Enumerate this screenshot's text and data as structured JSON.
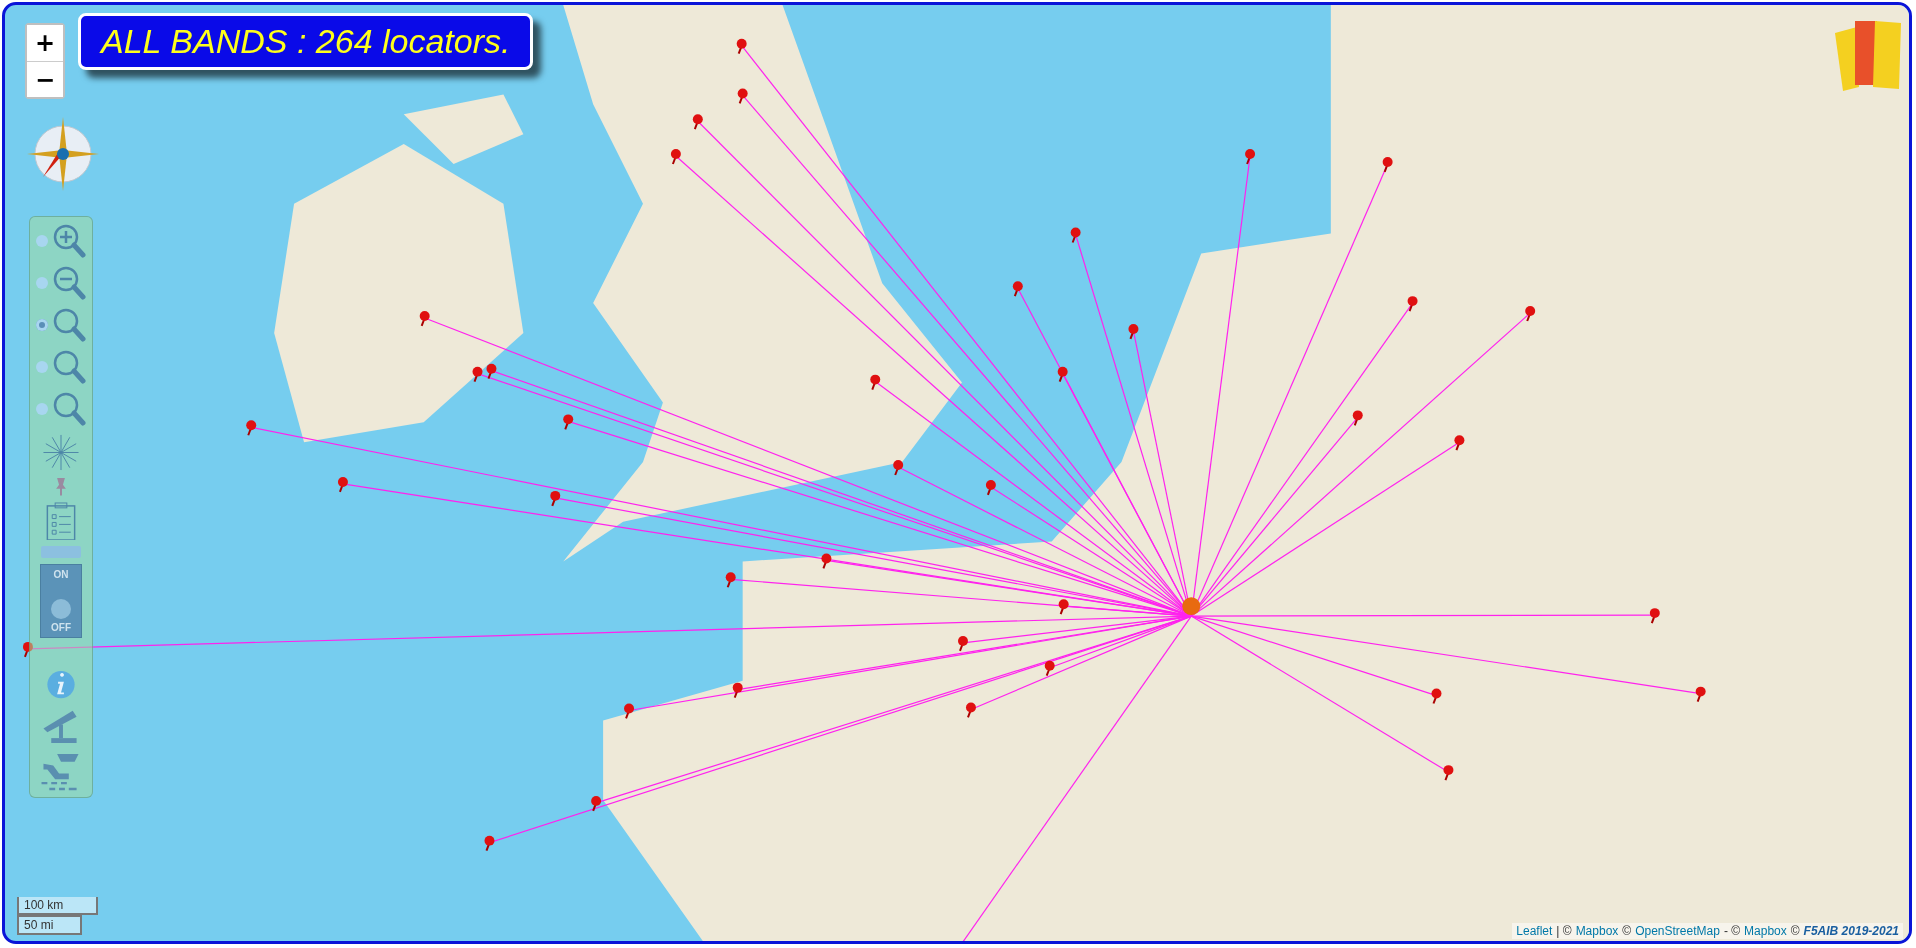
{
  "title": "ALL BANDS : 264 locators.",
  "zoom_controls": [
    "+",
    "−"
  ],
  "zoom_levels": [
    {
      "kind": "zoom-in",
      "selected": false
    },
    {
      "kind": "zoom-out",
      "selected": false
    },
    {
      "kind": "zoom",
      "selected": true
    },
    {
      "kind": "zoom",
      "selected": false
    },
    {
      "kind": "zoom",
      "selected": false
    }
  ],
  "toggle": {
    "on_label": "ON",
    "off_label": "OFF",
    "on": false
  },
  "scale": [
    "100 km",
    "50 mi"
  ],
  "attribution": [
    {
      "kind": "link",
      "text": "Leaflet"
    },
    {
      "kind": "text",
      "text": "| ©"
    },
    {
      "kind": "link",
      "text": "Mapbox"
    },
    {
      "kind": "text",
      "text": "©"
    },
    {
      "kind": "link",
      "text": "OpenStreetMap"
    },
    {
      "kind": "text",
      "text": "- ©"
    },
    {
      "kind": "link",
      "text": "Mapbox"
    },
    {
      "kind": "text",
      "text": "©"
    },
    {
      "kind": "credit",
      "text": "F5AIB 2019-2021"
    }
  ]
}
